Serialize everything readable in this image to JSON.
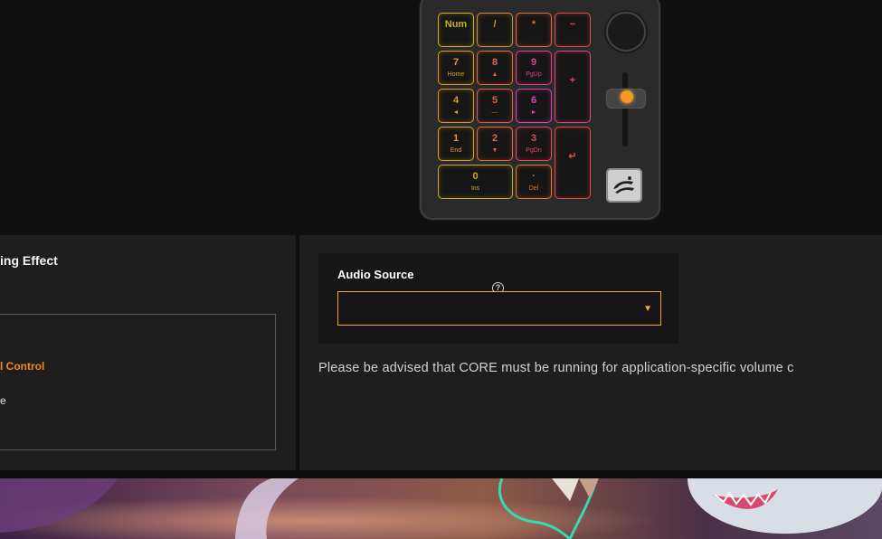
{
  "device": {
    "keys": [
      {
        "id": "num",
        "main": "Num",
        "sub": "",
        "color": "#c9b11f"
      },
      {
        "id": "slash",
        "main": "/",
        "sub": "",
        "color": "#d9902a"
      },
      {
        "id": "star",
        "main": "*",
        "sub": "",
        "color": "#e5683a"
      },
      {
        "id": "minus",
        "main": "−",
        "sub": "",
        "color": "#e34a4a"
      },
      {
        "id": "k7",
        "main": "7",
        "sub": "Home",
        "color": "#e09a22"
      },
      {
        "id": "k8",
        "main": "8",
        "sub": "▲",
        "color": "#e86a3a"
      },
      {
        "id": "k9",
        "main": "9",
        "sub": "PgUp",
        "color": "#e0408a"
      },
      {
        "id": "plus",
        "main": "+",
        "sub": "",
        "color": "#e0467a"
      },
      {
        "id": "k4",
        "main": "4",
        "sub": "◄",
        "color": "#e09a22"
      },
      {
        "id": "k5",
        "main": "5",
        "sub": "—",
        "color": "#e35c4a"
      },
      {
        "id": "k6",
        "main": "6",
        "sub": "►",
        "color": "#d946b8"
      },
      {
        "id": "k1",
        "main": "1",
        "sub": "End",
        "color": "#e0a11f"
      },
      {
        "id": "k2",
        "main": "2",
        "sub": "▼",
        "color": "#e56a3b"
      },
      {
        "id": "k3",
        "main": "3",
        "sub": "PgDn",
        "color": "#e04a5f"
      },
      {
        "id": "enter",
        "main": "↵",
        "sub": "",
        "color": "#e34a4a"
      },
      {
        "id": "k0",
        "main": "0",
        "sub": "Ins",
        "color": "#c7a92a"
      },
      {
        "id": "dot",
        "main": "·",
        "sub": "Del",
        "color": "#e07a2c"
      }
    ],
    "slider_level": 0.3
  },
  "left_panel": {
    "title": "ing Effect",
    "option_control": "l Control",
    "option_e": "e"
  },
  "right_panel": {
    "audio_label": "Audio Source",
    "help": "?",
    "audio_source_value": "",
    "caret": "▼",
    "notice": "Please be advised that CORE must be running for application-specific volume c"
  },
  "colors": {
    "accent": "#f2a737",
    "orange_text": "#f28a1e",
    "panel_bg": "#1e1e1e"
  }
}
